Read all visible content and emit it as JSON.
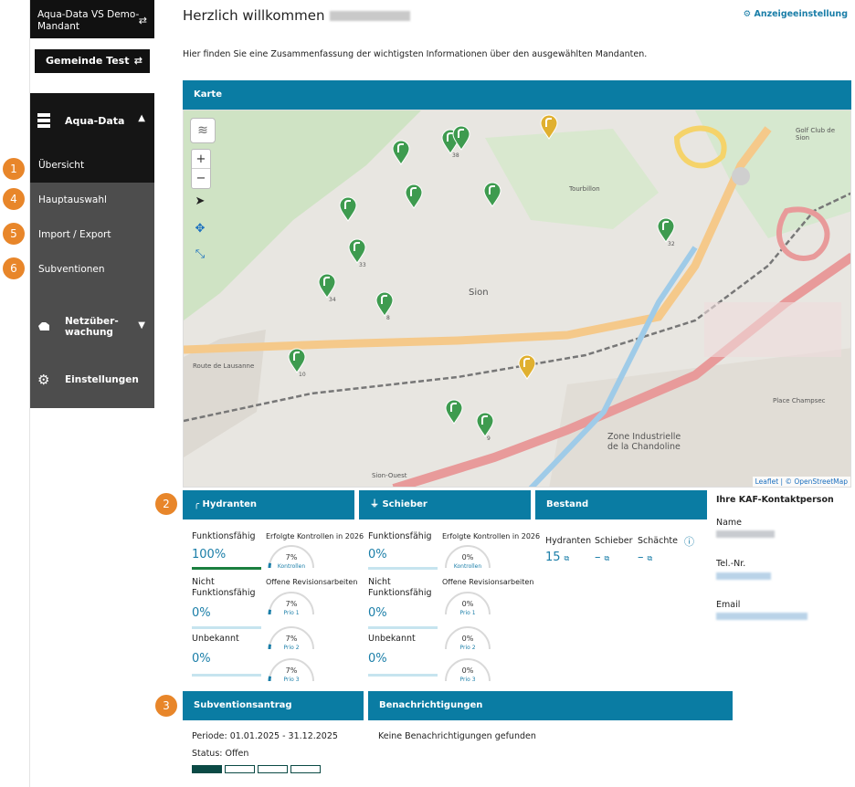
{
  "sidebar": {
    "tenant_switch": "Aqua-Data VS Demo-Mandant",
    "municipality": "Gemeinde Test",
    "aqua_data": "Aqua-Data",
    "sub_items": [
      "Übersicht",
      "Hauptauswahl",
      "Import / Export",
      "Subventionen"
    ],
    "network": "Netzüber-wachung",
    "settings": "Einstellungen"
  },
  "badges": [
    "1",
    "4",
    "5",
    "6",
    "2",
    "3"
  ],
  "header": {
    "welcome": "Herzlich willkommen",
    "display_settings": "Anzeigeeinstellung",
    "intro": "Hier finden Sie eine Zusammenfassung der wichtigsten Informationen über den ausgewählten Mandanten."
  },
  "map": {
    "title": "Karte",
    "attribution_leaflet": "Leaflet",
    "attribution_osm": "© OpenStreetMap",
    "labels": [
      "Sion",
      "Zone Industrielle de la Chandoline",
      "Golf Club de Sion",
      "Tourbillon",
      "Place Champsec",
      "Sion-Ouest",
      "Route de Lausanne"
    ],
    "marker_numbers": [
      "38",
      "33",
      "32",
      "34",
      "8",
      "10",
      "9"
    ]
  },
  "hydranten": {
    "title": "Hydranten",
    "functional_label": "Funktionsfähig",
    "functional_value": "100%",
    "functional_fraction": 1.0,
    "not_functional_label": "Nicht Funktionsfähig",
    "not_functional_value": "0%",
    "unknown_label": "Unbekannt",
    "unknown_value": "0%",
    "controls_label": "Erfolgte Kontrollen in 2026",
    "controls_value": "7%",
    "controls_sub": "Kontrollen",
    "revisions_label": "Offene Revisionsarbeiten",
    "prio": [
      {
        "value": "7%",
        "label": "Prio 1"
      },
      {
        "value": "7%",
        "label": "Prio 2"
      },
      {
        "value": "7%",
        "label": "Prio 3"
      }
    ]
  },
  "schieber": {
    "title": "Schieber",
    "functional_label": "Funktionsfähig",
    "functional_value": "0%",
    "not_functional_label": "Nicht Funktionsfähig",
    "not_functional_value": "0%",
    "unknown_label": "Unbekannt",
    "unknown_value": "0%",
    "controls_label": "Erfolgte Kontrollen in 2026",
    "controls_value": "0%",
    "controls_sub": "Kontrollen",
    "revisions_label": "Offene Revisionsarbeiten",
    "prio": [
      {
        "value": "0%",
        "label": "Prio 1"
      },
      {
        "value": "0%",
        "label": "Prio 2"
      },
      {
        "value": "0%",
        "label": "Prio 3"
      }
    ]
  },
  "bestand": {
    "title": "Bestand",
    "hydranten_label": "Hydranten",
    "hydranten_value": "15",
    "schieber_label": "Schieber",
    "schieber_value": "–",
    "schaechte_label": "Schächte",
    "schaechte_value": "–"
  },
  "contact": {
    "title": "Ihre KAF-Kontaktperson",
    "name_label": "Name",
    "phone_label": "Tel.-Nr.",
    "email_label": "Email"
  },
  "subvention": {
    "title": "Subventionsantrag",
    "period": "Periode: 01.01.2025 - 31.12.2025",
    "status": "Status: Offen"
  },
  "notifications": {
    "title": "Benachrichtigungen",
    "empty": "Keine Benachrichtigungen gefunden"
  },
  "colors": {
    "primary": "#0a7ca3",
    "sidebar_dark": "#151515",
    "sidebar_gray": "#4d4d4d",
    "badge": "#e8862a",
    "marker": "#3e9b4f",
    "marker_alt": "#e0b030"
  }
}
